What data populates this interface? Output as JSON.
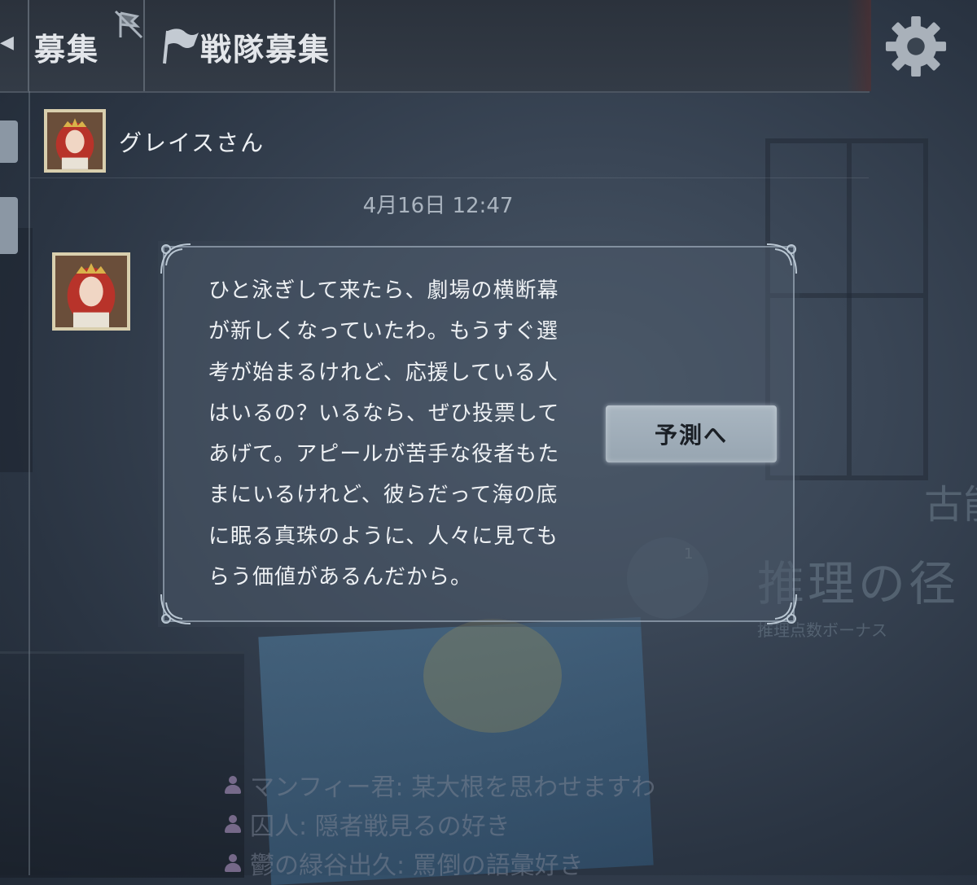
{
  "tabs": {
    "recruit_label": "募集",
    "team_recruit_label": "戦隊募集"
  },
  "chat": {
    "sender_name": "グレイスさん",
    "timestamp": "4月16日 12:47",
    "message_lines": [
      "ひと泳ぎして来たら、劇場の横断幕",
      "が新しくなっていたわ。もうすぐ選",
      "考が始まるけれど、応援している人",
      "はいるの？いるなら、ぜひ投票して",
      "あげて。アピールが苦手な役者もた",
      "まにいるけれど、彼らだって海の底",
      "に眠る真珠のように、人々に見ても",
      "らう価値があるんだから。"
    ],
    "action_button_label": "予測へ"
  },
  "background": {
    "deduction_title": "推理の径",
    "deduction_subtitle": "推理点数ボーナス",
    "deduction_count": "1",
    "corner_text": "古能",
    "ticker": [
      "マンフィー君: 某大根を思わせますわ",
      "囚人: 隠者戦見るの好き",
      "鬱の緑谷出久: 罵倒の語彙好き"
    ]
  },
  "colors": {
    "accent_button": "#a9b6c1",
    "text_primary": "#eef1f4",
    "timestamp": "#aab4bf"
  }
}
